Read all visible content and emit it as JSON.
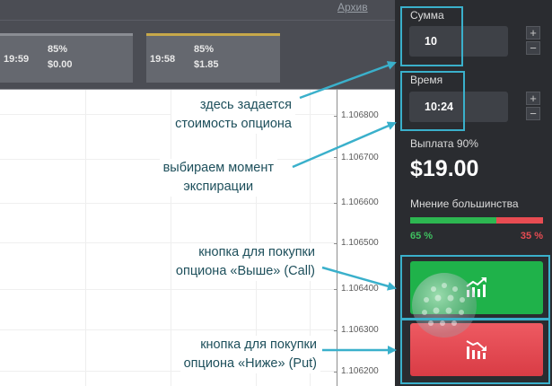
{
  "header": {
    "archive_link": "Архив"
  },
  "trades": [
    {
      "time": "19:59",
      "percent": "85%",
      "amount": "$0.00"
    },
    {
      "time": "19:58",
      "percent": "85%",
      "amount": "$1.85"
    }
  ],
  "chart": {
    "price_labels": [
      "1.106800",
      "1.106700",
      "1.106600",
      "1.106500",
      "1.106400",
      "1.106300",
      "1.106200"
    ]
  },
  "panel": {
    "amount_label": "Сумма",
    "amount_value": "10",
    "time_label": "Время",
    "time_value": "10:24",
    "plus": "+",
    "minus": "−",
    "payout_label": "Выплата 90%",
    "payout_value": "$19.00",
    "majority_label": "Мнение большинства",
    "majority_up_pct": "65 %",
    "majority_down_pct": "35 %",
    "majority_up_fraction": 0.65,
    "call_icon": "chart-up-icon",
    "put_icon": "chart-down-icon"
  },
  "annotations": {
    "amount_note_line1": "здесь задается",
    "amount_note_line2": "стоимость опциона",
    "time_note_line1": "выбираем момент",
    "time_note_line2": "экспирации",
    "call_note_line1": "кнопка для покупки",
    "call_note_line2": "опциона «Выше» (Call)",
    "put_note_line1": "кнопка для покупки",
    "put_note_line2": "опциона «Ниже» (Put)"
  },
  "colors": {
    "call_green": "#1fb24a",
    "put_red": "#e84c52",
    "highlight": "#3ab0cb",
    "panel_bg": "#2a2c30"
  }
}
